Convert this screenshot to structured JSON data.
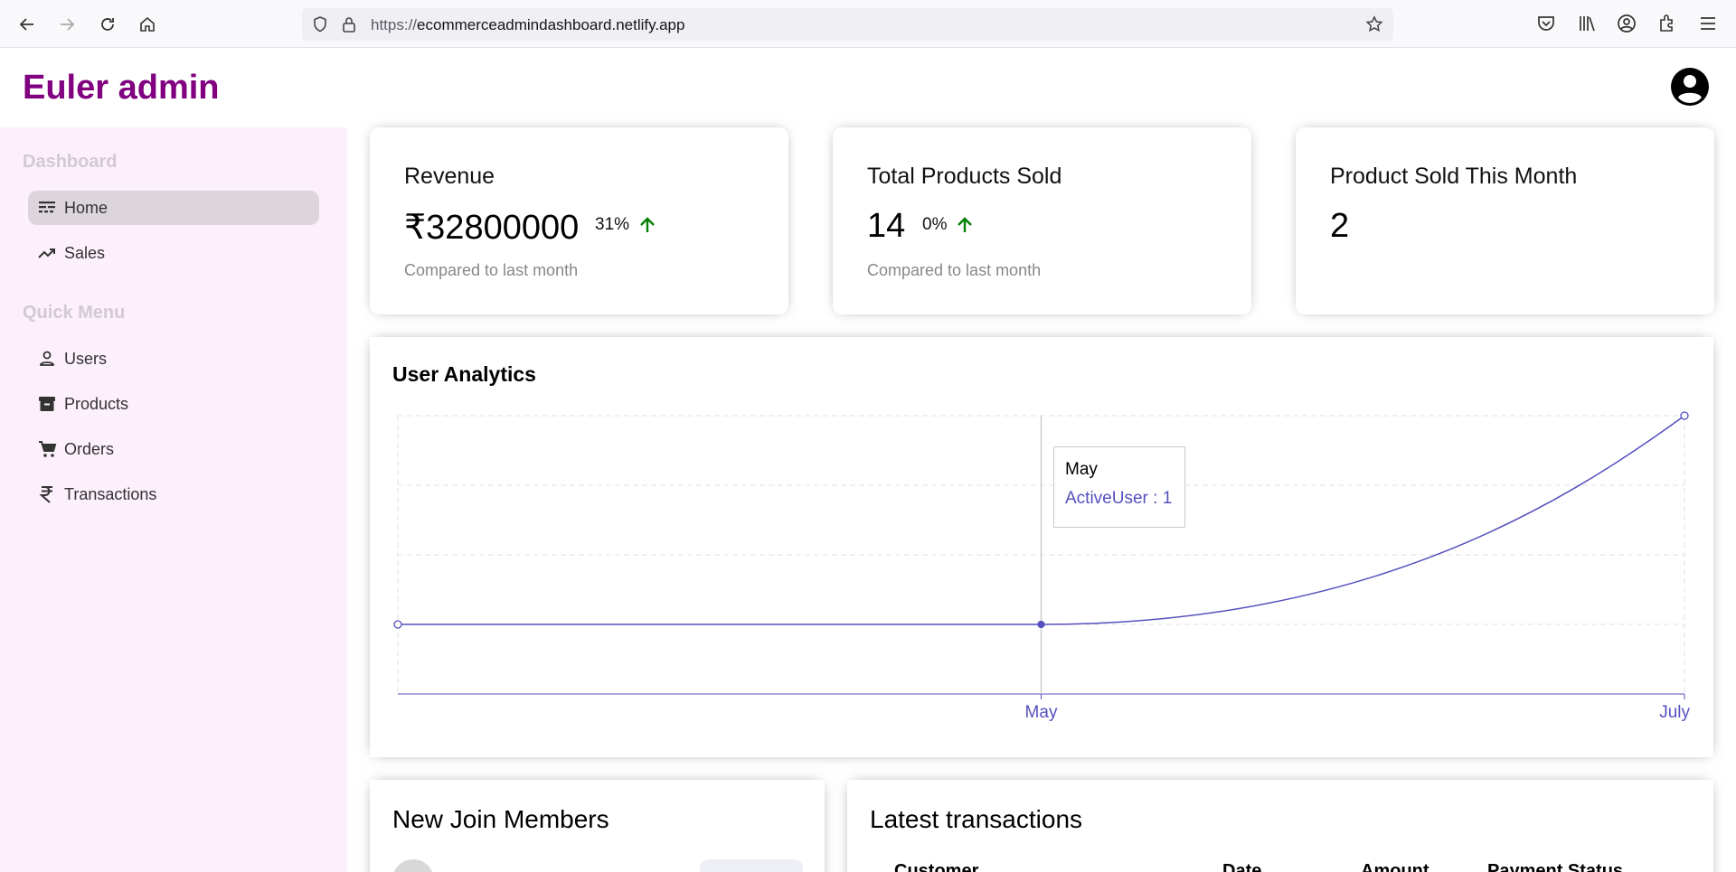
{
  "browser": {
    "url_host": "ecommerceadmindashboard.netlify.app",
    "url_prefix": "https://"
  },
  "app": {
    "logo": "Euler admin"
  },
  "sidebar": {
    "sections": [
      {
        "title": "Dashboard",
        "items": [
          {
            "label": "Home",
            "icon": "line-style-icon",
            "active": true
          },
          {
            "label": "Sales",
            "icon": "trending-up-icon",
            "active": false
          }
        ]
      },
      {
        "title": "Quick Menu",
        "items": [
          {
            "label": "Users",
            "icon": "person-outline-icon",
            "active": false
          },
          {
            "label": "Products",
            "icon": "archive-icon",
            "active": false
          },
          {
            "label": "Orders",
            "icon": "shopping-cart-icon",
            "active": false
          },
          {
            "label": "Transactions",
            "icon": "rupee-icon",
            "active": false
          }
        ]
      }
    ]
  },
  "cards": [
    {
      "title": "Revenue",
      "value": "₹32800000",
      "rate": "31%",
      "subtitle": "Compared to last month",
      "trend": "up"
    },
    {
      "title": "Total Products Sold",
      "value": "14",
      "rate": "0%",
      "subtitle": "Compared to last month",
      "trend": "up"
    },
    {
      "title": "Product Sold This Month",
      "value": "2",
      "rate": "",
      "subtitle": "",
      "trend": ""
    }
  ],
  "chart": {
    "title": "User Analytics",
    "tooltip": {
      "label": "May",
      "item": "ActiveUser : 1"
    }
  },
  "chart_data": {
    "type": "line",
    "x": [
      "",
      "May",
      "July"
    ],
    "series": [
      {
        "name": "ActiveUser",
        "values": [
          1,
          1,
          4
        ]
      }
    ],
    "xlabel": "",
    "ylabel": "",
    "ylim": [
      0,
      4
    ],
    "grid": true,
    "color": "#5550bd"
  },
  "widgets": {
    "members_title": "New Join Members",
    "transactions_title": "Latest transactions",
    "table_headers": [
      "Customer",
      "Date",
      "Amount",
      "Payment Status"
    ]
  },
  "colors": {
    "brand": "#800080",
    "accent": "#5550bd",
    "positive": "#008000"
  }
}
